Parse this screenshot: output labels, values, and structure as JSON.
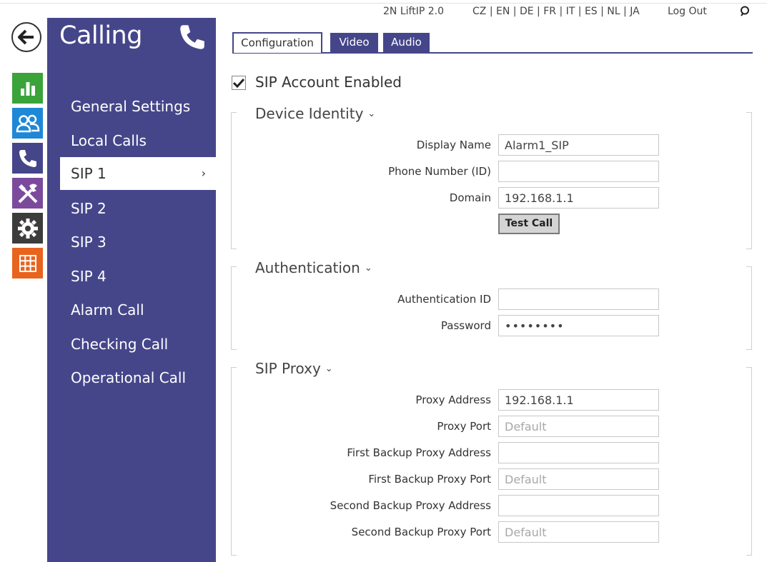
{
  "topbar": {
    "device": "2N LiftIP 2.0",
    "languages": [
      "CZ",
      "EN",
      "DE",
      "FR",
      "IT",
      "ES",
      "NL",
      "JA"
    ],
    "logout": "Log Out"
  },
  "rail": {
    "icons": [
      {
        "name": "status-icon",
        "color": "#3aa33a"
      },
      {
        "name": "directory-icon",
        "color": "#1e88d6"
      },
      {
        "name": "calling-icon",
        "color": "#45468a"
      },
      {
        "name": "hardware-icon",
        "color": "#7b4a9c"
      },
      {
        "name": "services-icon",
        "color": "#3c3c3c"
      },
      {
        "name": "system-icon",
        "color": "#e8641e"
      }
    ]
  },
  "sidebar": {
    "title": "Calling",
    "items": [
      {
        "label": "General Settings"
      },
      {
        "label": "Local Calls"
      },
      {
        "label": "SIP 1",
        "active": true,
        "chevron": "›"
      },
      {
        "label": "SIP 2"
      },
      {
        "label": "SIP 3"
      },
      {
        "label": "SIP 4"
      },
      {
        "label": "Alarm Call"
      },
      {
        "label": "Checking Call"
      },
      {
        "label": "Operational Call"
      }
    ]
  },
  "tabs": [
    {
      "label": "Configuration",
      "active": true
    },
    {
      "label": "Video"
    },
    {
      "label": "Audio"
    }
  ],
  "sip_enabled": {
    "label": "SIP Account Enabled",
    "checked": true
  },
  "sections": {
    "device_identity": {
      "title": "Device Identity",
      "fields": {
        "display_name": {
          "label": "Display Name",
          "value": "Alarm1_SIP"
        },
        "phone_number": {
          "label": "Phone Number (ID)",
          "value": ""
        },
        "domain": {
          "label": "Domain",
          "value": "192.168.1.1"
        }
      },
      "test_call": "Test Call"
    },
    "authentication": {
      "title": "Authentication",
      "fields": {
        "auth_id": {
          "label": "Authentication ID",
          "value": ""
        },
        "password": {
          "label": "Password",
          "value": "••••••••"
        }
      }
    },
    "sip_proxy": {
      "title": "SIP Proxy",
      "fields": {
        "proxy_address": {
          "label": "Proxy Address",
          "value": "192.168.1.1"
        },
        "proxy_port": {
          "label": "Proxy Port",
          "value": "",
          "placeholder": "Default"
        },
        "first_backup_address": {
          "label": "First Backup Proxy Address",
          "value": ""
        },
        "first_backup_port": {
          "label": "First Backup Proxy Port",
          "value": "",
          "placeholder": "Default"
        },
        "second_backup_address": {
          "label": "Second Backup Proxy Address",
          "value": ""
        },
        "second_backup_port": {
          "label": "Second Backup Proxy Port",
          "value": "",
          "placeholder": "Default"
        }
      }
    }
  }
}
